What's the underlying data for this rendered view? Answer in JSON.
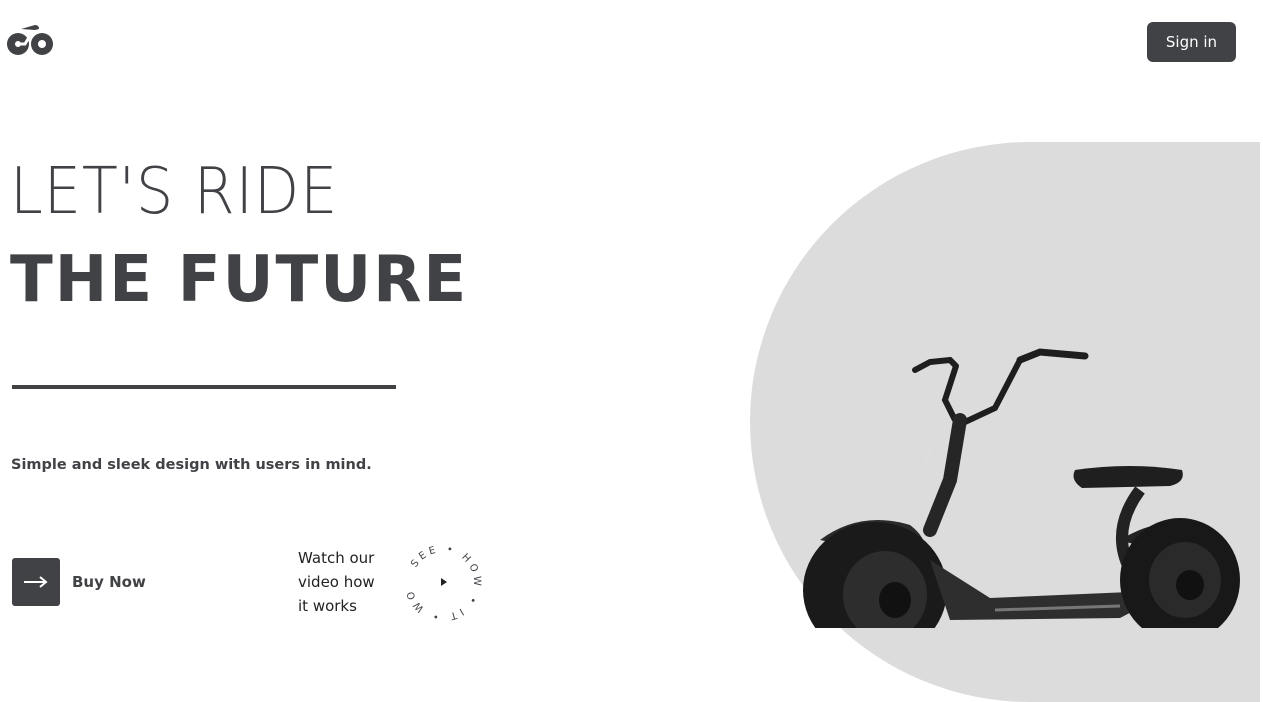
{
  "header": {
    "logo_icon": "scooter-logo-icon",
    "signin_label": "Sign in"
  },
  "hero": {
    "line1": "LET'S RIDE",
    "line2": "THE FUTURE",
    "tagline": "Simple and sleek design with users in mind."
  },
  "actions": {
    "buy_icon": "arrow-right-icon",
    "buy_label": "Buy Now",
    "watch_line1": "Watch our",
    "watch_line2": "video how",
    "watch_line3": "it works",
    "circle_text": "SEE • HOW • IT • WORKS •",
    "play_icon": "play-icon"
  },
  "image": {
    "subject": "electric-scooter-image"
  },
  "colors": {
    "primary": "#404246",
    "background": "#ffffff",
    "shape": "#dcdcdc"
  }
}
